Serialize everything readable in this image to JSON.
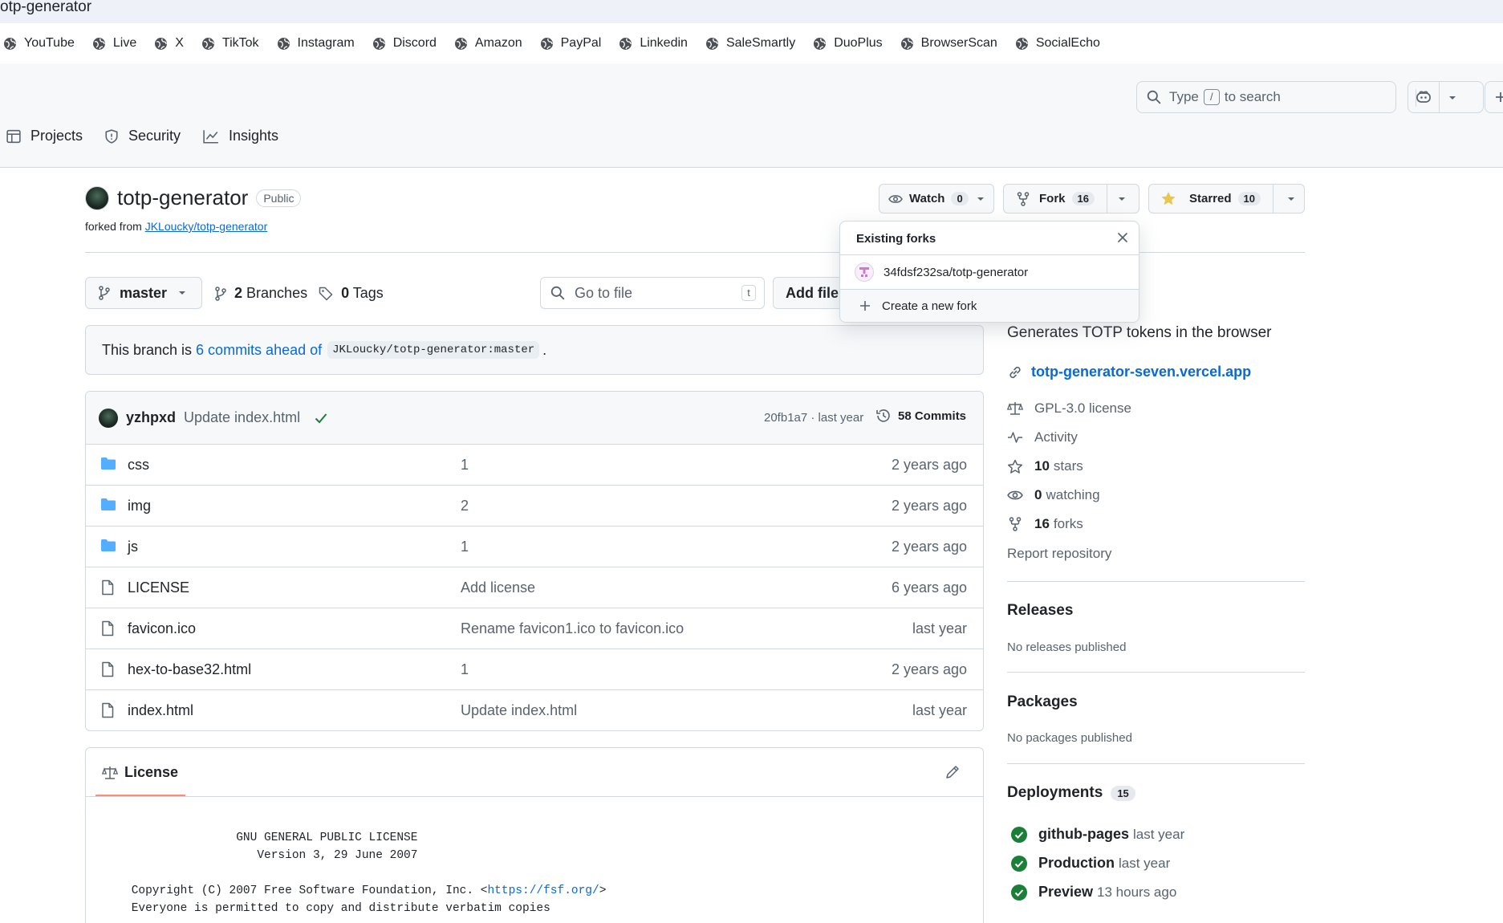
{
  "window": {
    "title": "otp-generator"
  },
  "bookmarks": [
    "YouTube",
    "Live",
    "X",
    "TikTok",
    "Instagram",
    "Discord",
    "Amazon",
    "PayPal",
    "Linkedin",
    "SaleSmartly",
    "DuoPlus",
    "BrowserScan",
    "SocialEcho"
  ],
  "header": {
    "search_prefix": "Type",
    "search_key": "/",
    "search_suffix": "to search",
    "tabs": [
      {
        "label": "Projects"
      },
      {
        "label": "Security"
      },
      {
        "label": "Insights"
      }
    ]
  },
  "repo": {
    "name": "totp-generator",
    "visibility": "Public",
    "forked_prefix": "forked from",
    "forked_link": "JKLoucky/totp-generator",
    "watch_label": "Watch",
    "watch_count": "0",
    "fork_label": "Fork",
    "fork_count": "16",
    "star_label": "Starred",
    "star_count": "10"
  },
  "branch": {
    "current": "master",
    "branches_count": "2",
    "branches_label": "Branches",
    "tags_count": "0",
    "tags_label": "Tags",
    "goto_placeholder": "Go to file",
    "goto_key": "t",
    "add_file_label": "Add file"
  },
  "ahead": {
    "prefix": "This branch is",
    "link": "6 commits ahead of",
    "ref": "JKLoucky/totp-generator:master",
    "suffix": "."
  },
  "last_commit": {
    "user": "yzhpxd",
    "message": "Update index.html",
    "hash_time": "20fb1a7 · last year",
    "commits_label": "58 Commits"
  },
  "files": [
    {
      "name": "css",
      "type": "folder",
      "commit": "1",
      "time": "2 years ago"
    },
    {
      "name": "img",
      "type": "folder",
      "commit": "2",
      "time": "2 years ago"
    },
    {
      "name": "js",
      "type": "folder",
      "commit": "1",
      "time": "2 years ago"
    },
    {
      "name": "LICENSE",
      "type": "file",
      "commit": "Add license",
      "time": "6 years ago"
    },
    {
      "name": "favicon.ico",
      "type": "file",
      "commit": "Rename favicon1.ico to favicon.ico",
      "time": "last year"
    },
    {
      "name": "hex-to-base32.html",
      "type": "file",
      "commit": "1",
      "time": "2 years ago"
    },
    {
      "name": "index.html",
      "type": "file",
      "commit": "Update index.html",
      "time": "last year"
    }
  ],
  "license": {
    "tab_label": "License",
    "line1": "                GNU GENERAL PUBLIC LICENSE",
    "line2": "                   Version 3, 29 June 2007",
    "line3_prefix": " Copyright (C) 2007 Free Software Foundation, Inc. <",
    "line3_link": "https://fsf.org/",
    "line3_suffix": ">",
    "line4": " Everyone is permitted to copy and distribute verbatim copies"
  },
  "sidebar": {
    "about": "Generates TOTP tokens in the browser",
    "website": "totp-generator-seven.vercel.app",
    "license": "GPL-3.0 license",
    "activity": "Activity",
    "stars_count": "10",
    "stars_label": "stars",
    "watching_count": "0",
    "watching_label": "watching",
    "forks_count": "16",
    "forks_label": "forks",
    "report": "Report repository",
    "releases_title": "Releases",
    "releases_empty": "No releases published",
    "packages_title": "Packages",
    "packages_empty": "No packages published",
    "deployments_title": "Deployments",
    "deployments_count": "15",
    "deployments": [
      {
        "name": "github-pages",
        "time": "last year"
      },
      {
        "name": "Production",
        "time": "last year"
      },
      {
        "name": "Preview",
        "time": "13 hours ago"
      }
    ]
  },
  "fork_popup": {
    "title": "Existing forks",
    "existing": "34fdsf232sa/totp-generator",
    "create": "Create a new fork"
  },
  "colors": {
    "accent": "#0969da",
    "success": "#1a7f37",
    "star": "#eac54f",
    "folder": "#54aeff"
  }
}
